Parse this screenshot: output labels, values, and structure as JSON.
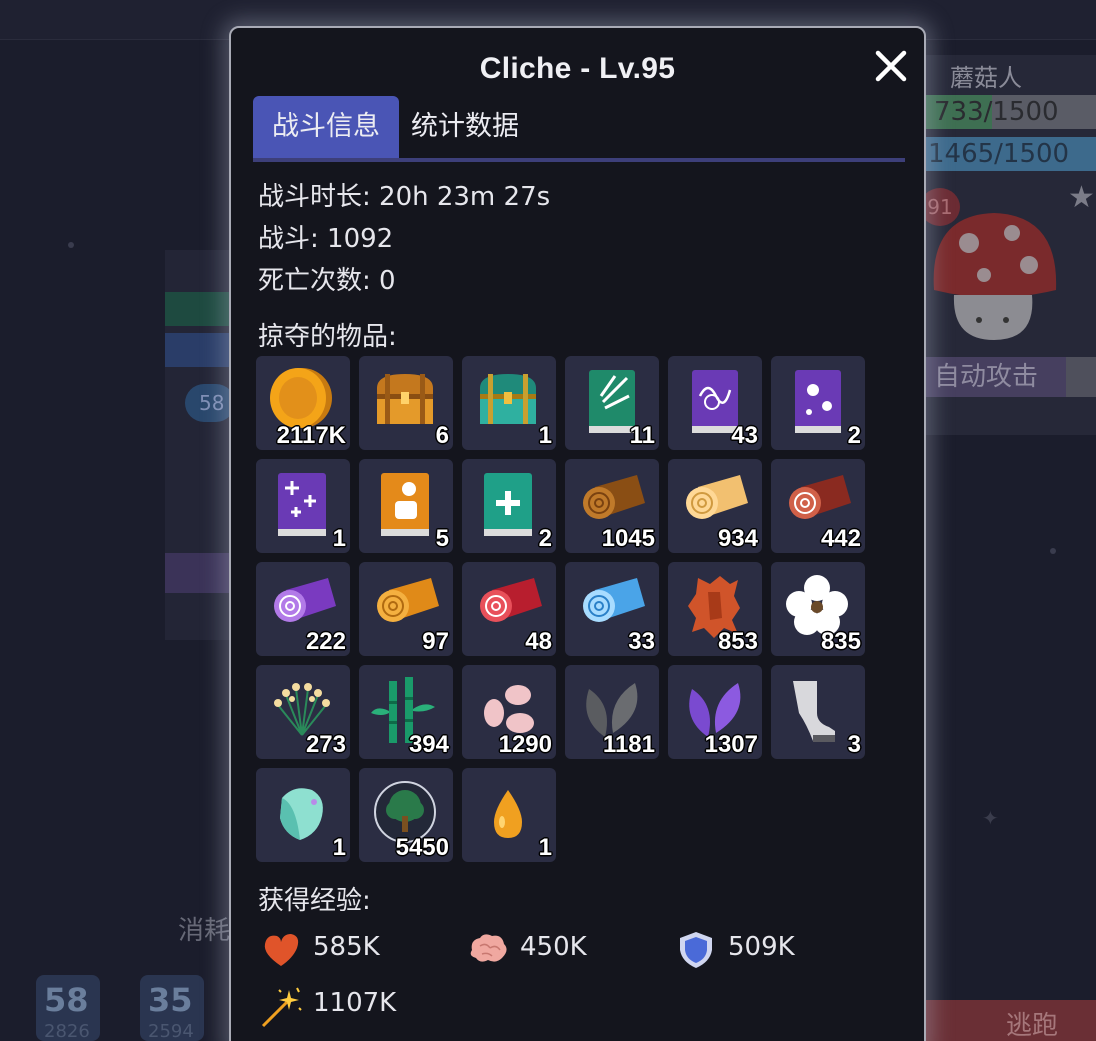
{
  "background": {
    "enemy_name": "蘑菇人",
    "enemy_hp": "733/1500",
    "enemy_mp": "1465/1500",
    "enemy_badge": "91",
    "left_pill": "58",
    "auto_attack_label": "自动攻击",
    "consume_label": "消耗",
    "slots": [
      {
        "big": "58",
        "small": "2826"
      },
      {
        "big": "35",
        "small": "2594"
      }
    ],
    "flee_label": "逃跑"
  },
  "modal": {
    "title": "Cliche - Lv.95",
    "close_icon": "close-icon",
    "tabs": [
      {
        "label": "战斗信息",
        "active": true
      },
      {
        "label": "统计数据",
        "active": false
      }
    ],
    "duration": "战斗时长: 20h 23m 27s",
    "battles": "战斗: 1092",
    "deaths": "死亡次数: 0",
    "loot_label": "掠夺的物品:",
    "loot": [
      {
        "icon": "gold-coin-icon",
        "count": "2117K"
      },
      {
        "icon": "wooden-chest-icon",
        "count": "6"
      },
      {
        "icon": "green-chest-icon",
        "count": "1"
      },
      {
        "icon": "green-book-icon",
        "count": "11"
      },
      {
        "icon": "purple-book-swirl-icon",
        "count": "43"
      },
      {
        "icon": "purple-book-flower-icon",
        "count": "2"
      },
      {
        "icon": "purple-book-sparkle-icon",
        "count": "1"
      },
      {
        "icon": "orange-book-icon",
        "count": "5"
      },
      {
        "icon": "teal-book-plus-icon",
        "count": "2"
      },
      {
        "icon": "brown-log-icon",
        "count": "1045"
      },
      {
        "icon": "light-log-icon",
        "count": "934"
      },
      {
        "icon": "red-brown-log-icon",
        "count": "442"
      },
      {
        "icon": "purple-log-icon",
        "count": "222"
      },
      {
        "icon": "orange-log-icon",
        "count": "97"
      },
      {
        "icon": "red-log-icon",
        "count": "48"
      },
      {
        "icon": "blue-log-icon",
        "count": "33"
      },
      {
        "icon": "leather-hide-icon",
        "count": "853"
      },
      {
        "icon": "cotton-icon",
        "count": "835"
      },
      {
        "icon": "flax-icon",
        "count": "273"
      },
      {
        "icon": "bamboo-icon",
        "count": "394"
      },
      {
        "icon": "beans-icon",
        "count": "1290"
      },
      {
        "icon": "gray-leaves-icon",
        "count": "1181"
      },
      {
        "icon": "purple-leaves-icon",
        "count": "1307"
      },
      {
        "icon": "boot-icon",
        "count": "3"
      },
      {
        "icon": "crystal-shard-icon",
        "count": "1"
      },
      {
        "icon": "tree-orb-icon",
        "count": "5450"
      },
      {
        "icon": "orange-drop-icon",
        "count": "1"
      }
    ],
    "xp_label": "获得经验:",
    "xp": [
      {
        "icon": "heart-icon",
        "value": "585K"
      },
      {
        "icon": "brain-icon",
        "value": "450K"
      },
      {
        "icon": "shield-icon",
        "value": "509K"
      },
      {
        "icon": "magic-wand-icon",
        "value": "1107K"
      }
    ]
  }
}
